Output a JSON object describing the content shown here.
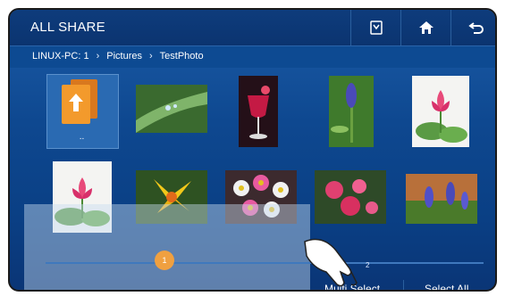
{
  "header": {
    "title": "ALL SHARE",
    "icons": [
      "tv-share-icon",
      "home-icon",
      "back-icon"
    ]
  },
  "breadcrumb": [
    "LINUX-PC: 1",
    "Pictures",
    "TestPhoto"
  ],
  "breadcrumb_separator": "›",
  "grid": {
    "parent_label": "..",
    "items": [
      {
        "name": "folder-up"
      },
      {
        "name": "dew-leaf"
      },
      {
        "name": "wine-glass"
      },
      {
        "name": "grape-hyacinth"
      },
      {
        "name": "lotus-white"
      },
      {
        "name": "lotus-pink"
      },
      {
        "name": "yellow-flower"
      },
      {
        "name": "daisies"
      },
      {
        "name": "pink-flowers"
      },
      {
        "name": "purple-hyacinth"
      }
    ]
  },
  "pager": {
    "current": "1",
    "next": "2"
  },
  "actions": {
    "multi_select": "Multi Select",
    "select_all": "Select All"
  },
  "colors": {
    "accent": "#0e4890",
    "topbar": "#0b3470",
    "knob": "#f0a040"
  }
}
